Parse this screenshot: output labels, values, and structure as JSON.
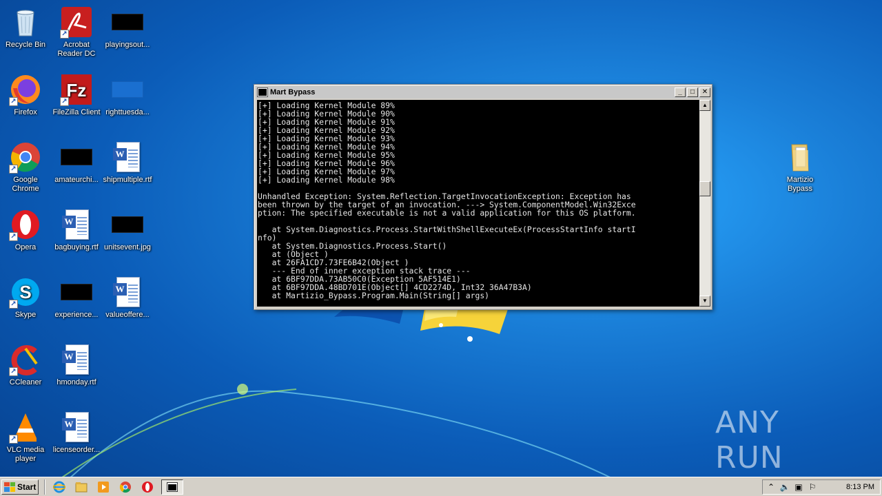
{
  "desktop": {
    "icons": [
      {
        "label": "Recycle Bin",
        "icon": "recycle-bin-icon"
      },
      {
        "label": "Acrobat Reader DC",
        "icon": "acrobat-icon"
      },
      {
        "label": "playingsout...",
        "icon": "black-thumbnail-icon"
      },
      {
        "label": "Firefox",
        "icon": "firefox-icon"
      },
      {
        "label": "FileZilla Client",
        "icon": "filezilla-icon"
      },
      {
        "label": "righttuesda...",
        "icon": "blue-thumbnail-icon"
      },
      {
        "label": "Google Chrome",
        "icon": "chrome-icon"
      },
      {
        "label": "amateurchi...",
        "icon": "black-thumbnail-icon"
      },
      {
        "label": "shipmultiple.rtf",
        "icon": "word-document-icon"
      },
      {
        "label": "Opera",
        "icon": "opera-icon"
      },
      {
        "label": "bagbuying.rtf",
        "icon": "word-document-icon"
      },
      {
        "label": "unitsevent.jpg",
        "icon": "black-thumbnail-icon"
      },
      {
        "label": "Skype",
        "icon": "skype-icon"
      },
      {
        "label": "experience...",
        "icon": "black-thumbnail-icon"
      },
      {
        "label": "valueoffere...",
        "icon": "word-document-icon"
      },
      {
        "label": "CCleaner",
        "icon": "ccleaner-icon"
      },
      {
        "label": "hmonday.rtf",
        "icon": "word-document-icon"
      },
      {
        "label": "VLC media player",
        "icon": "vlc-icon"
      },
      {
        "label": "licenseorder...",
        "icon": "word-document-icon"
      },
      {
        "label": "Martizio Bypass",
        "icon": "folder-icon"
      }
    ]
  },
  "window": {
    "title": "Mart Bypass",
    "minimize": "_",
    "maximize": "□",
    "close": "✕",
    "console_text": "[+] Loading Kernel Module 89%\n[+] Loading Kernel Module 90%\n[+] Loading Kernel Module 91%\n[+] Loading Kernel Module 92%\n[+] Loading Kernel Module 93%\n[+] Loading Kernel Module 94%\n[+] Loading Kernel Module 95%\n[+] Loading Kernel Module 96%\n[+] Loading Kernel Module 97%\n[+] Loading Kernel Module 98%\n\nUnhandled Exception: System.Reflection.TargetInvocationException: Exception has\nbeen thrown by the target of an invocation. ---> System.ComponentModel.Win32Exce\nption: The specified executable is not a valid application for this OS platform.\n\n   at System.Diagnostics.Process.StartWithShellExecuteEx(ProcessStartInfo startI\nnfo)\n   at System.Diagnostics.Process.Start()\n   at (Object )\n   at 26FA1CD7.73FE6B42(Object )\n   --- End of inner exception stack trace ---\n   at 6BF97DDA.73AB50C0(Exception 5AF514E1)\n   at 6BF97DDA.48BD701E(Object[] 4CD2274D, Int32 36A47B3A)\n   at Martizio_Bypass.Program.Main(String[] args)",
    "scroll_up": "▲",
    "scroll_down": "▼"
  },
  "taskbar": {
    "start_label": "Start",
    "clock": "8:13 PM",
    "tray_expand": "⌃"
  },
  "watermark": {
    "text": "ANY RUN"
  },
  "colors": {
    "console_bg": "#000000",
    "console_fg": "#e6e6e6",
    "wallpaper": "#1a7fd8"
  }
}
